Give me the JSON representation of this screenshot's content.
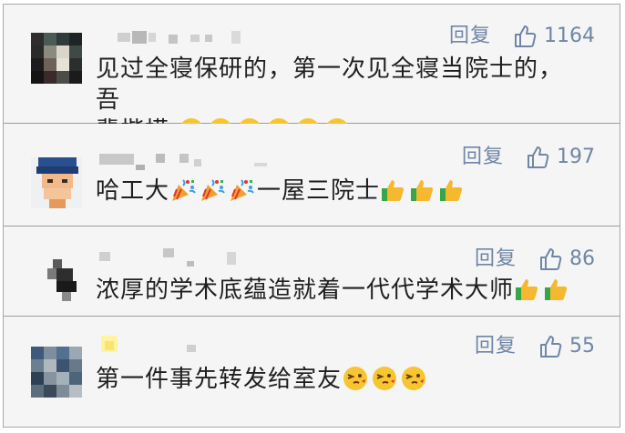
{
  "colors": {
    "card_bg": "#f5f5f5",
    "divider": "#9c9c9c",
    "action_text": "#6f86a6",
    "comment_text": "#1f1f1f"
  },
  "comments": [
    {
      "reply_label": "回复",
      "like_count": "1164",
      "text_line1": "见过全寝保研的，第一次见全寝当院士的，吾",
      "text_line2": "辈楷模",
      "emoji": [
        "crying-face",
        "crying-face",
        "crying-face",
        "crying-face",
        "crying-face",
        "crying-face"
      ]
    },
    {
      "reply_label": "回复",
      "like_count": "197",
      "text_a": "哈工大",
      "text_b": "一屋三院士",
      "emoji_mid": [
        "party-popper",
        "party-popper",
        "party-popper"
      ],
      "emoji_end": [
        "thumbs-up",
        "thumbs-up",
        "thumbs-up"
      ]
    },
    {
      "reply_label": "回复",
      "like_count": "86",
      "text": "浓厚的学术底蕴造就着一代代学术大师",
      "emoji": [
        "thumbs-up",
        "thumbs-up"
      ]
    },
    {
      "reply_label": "回复",
      "like_count": "55",
      "text": "第一件事先转发给室友",
      "emoji": [
        "wink-kiss-face",
        "wink-kiss-face",
        "wink-kiss-face"
      ]
    }
  ]
}
